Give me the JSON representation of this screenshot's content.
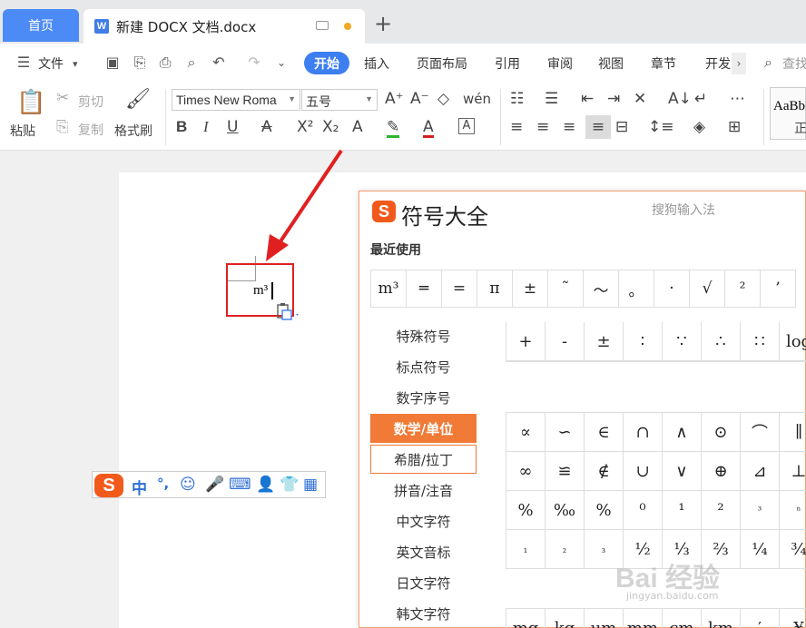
{
  "tabs": {
    "home": "首页",
    "doc_title": "新建 DOCX 文档.docx",
    "plus": "+"
  },
  "menu": {
    "file": "文件",
    "items": [
      "开始",
      "插入",
      "页面布局",
      "引用",
      "审阅",
      "视图",
      "章节",
      "开发"
    ],
    "search": "查找"
  },
  "ribbon": {
    "paste": "粘贴",
    "cut": "剪切",
    "copy": "复制",
    "format_painter": "格式刷",
    "font": "Times New Roma",
    "size": "五号",
    "style_preview": "AaBb",
    "style_name": "正"
  },
  "document": {
    "text": "m³"
  },
  "ime_bar": {
    "lang": "中",
    "punct": "°,"
  },
  "symbol_panel": {
    "title": "符号大全",
    "brand": "搜狗输入法",
    "recent_label": "最近使用",
    "recent": [
      "m³",
      "═",
      "=",
      "π",
      "±",
      "˜",
      "～",
      "。",
      "·",
      "√",
      "²",
      "’"
    ],
    "categories": [
      "特殊符号",
      "标点符号",
      "数字序号",
      "数学/单位",
      "希腊/拉丁",
      "拼音/注音",
      "中文字符",
      "英文音标",
      "日文字符",
      "韩文字符"
    ],
    "active_category": "数学/单位",
    "grid_top": [
      "+",
      "-",
      "±",
      "∶",
      "∵",
      "∴",
      "∷",
      "log"
    ],
    "grid": [
      "∝",
      "∽",
      "∈",
      "∩",
      "∧",
      "⊙",
      "⌒",
      "∥",
      "∞",
      "≌",
      "∉",
      "∪",
      "∨",
      "⊕",
      "⊿",
      "⊥",
      "%",
      "‰",
      "%",
      "⁰",
      "¹",
      "²",
      "³",
      "ⁿ",
      "₁",
      "₂",
      "₃",
      "½",
      "⅓",
      "⅔",
      "¼",
      "¾"
    ],
    "grid_bottom": [
      "mg",
      "kg",
      "μm",
      "mm",
      "cm",
      "km",
      "′",
      "¥"
    ]
  },
  "watermark": {
    "text": "Bai 经验",
    "url": "jingyan.baidu.com"
  },
  "colors": {
    "accent": "#3d7ef0",
    "sogou": "#f25a1c",
    "highlight_box": "#e02020"
  }
}
